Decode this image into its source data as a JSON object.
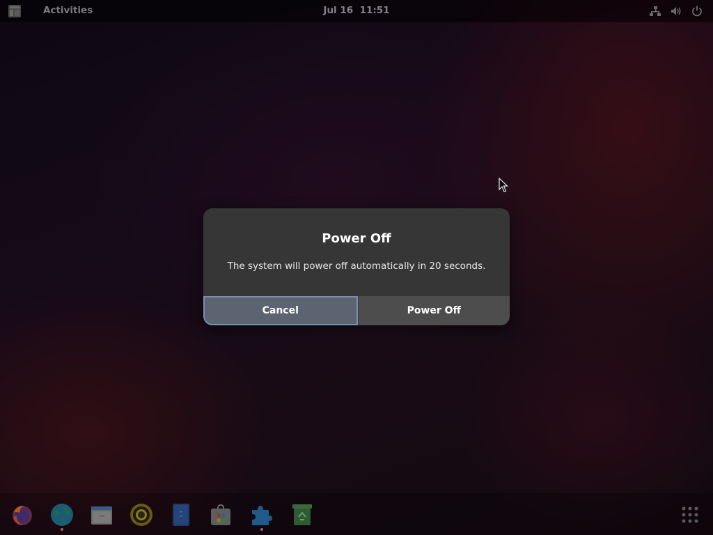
{
  "topbar": {
    "activities_label": "Activities",
    "date": "Jul 16",
    "time": "11:51"
  },
  "tray_icons": [
    "network-icon",
    "volume-icon",
    "power-icon"
  ],
  "dialog": {
    "title": "Power Off",
    "message": "The system will power off automatically in 20 seconds.",
    "cancel_label": "Cancel",
    "confirm_label": "Power Off"
  },
  "dock": {
    "apps": [
      "firefox-icon",
      "browser-globe-icon",
      "files-icon",
      "rhythmbox-icon",
      "text-editor-icon",
      "software-center-icon",
      "extensions-icon",
      "trash-icon"
    ],
    "running": [
      "browser-globe-icon",
      "extensions-icon"
    ],
    "show_apps_icon": "app-grid-icon"
  },
  "colors": {
    "dialog_bg": "#363636",
    "cancel_focus_border": "#7790b2",
    "topbar_bg": "rgba(0,0,0,0.55)"
  }
}
